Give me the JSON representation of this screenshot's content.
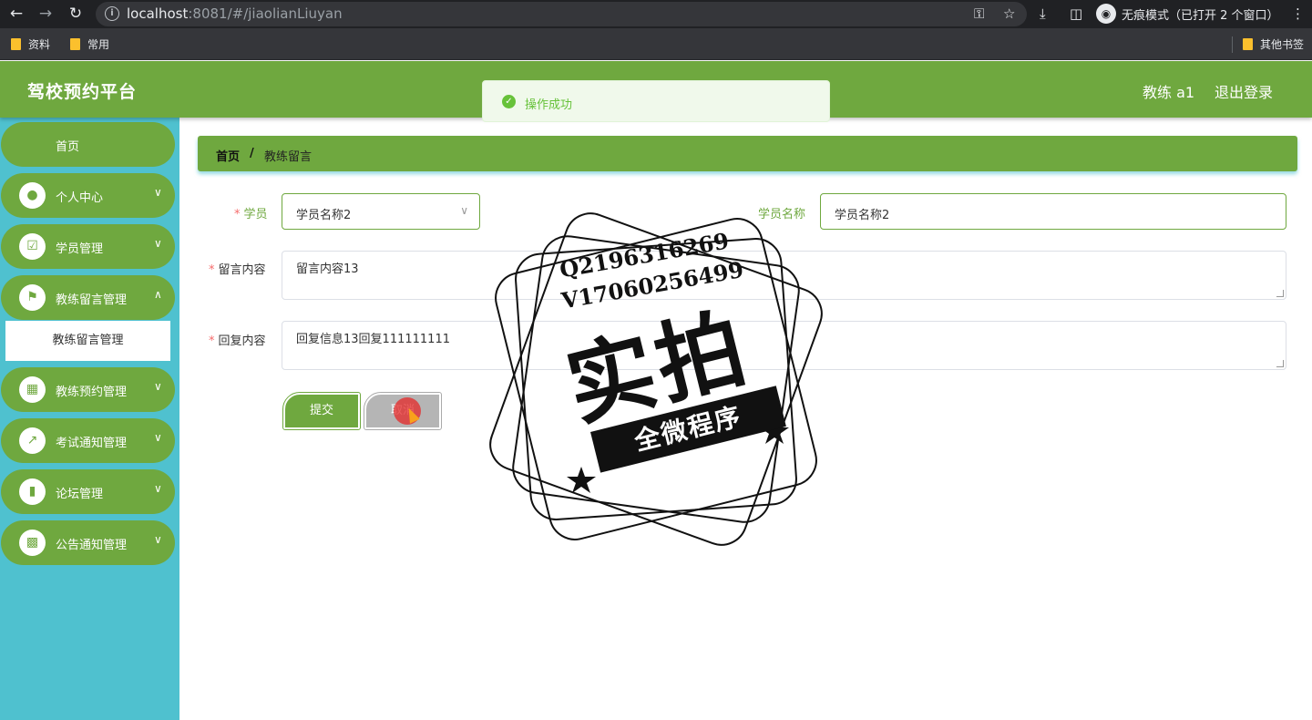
{
  "browser": {
    "url_host": "localhost",
    "url_path": ":8081/#/jiaolianLiuyan",
    "incognito_label": "无痕模式（已打开 2 个窗口）",
    "bookmarks": [
      "资料",
      "常用"
    ],
    "other_bookmarks": "其他书签",
    "icons": [
      "back-icon",
      "forward-icon",
      "reload-icon",
      "info-icon",
      "key-icon",
      "star-icon",
      "download-icon",
      "sidepanel-icon",
      "incognito-icon",
      "more-icon"
    ]
  },
  "header": {
    "title": "驾校预约平台",
    "user": "教练 a1",
    "logout": "退出登录"
  },
  "toast": {
    "message": "操作成功"
  },
  "sidebar": {
    "items": [
      {
        "label": "首页"
      },
      {
        "label": "个人中心"
      },
      {
        "label": "学员管理"
      },
      {
        "label": "教练留言管理"
      },
      {
        "label": "教练预约管理"
      },
      {
        "label": "考试通知管理"
      },
      {
        "label": "论坛管理"
      },
      {
        "label": "公告通知管理"
      }
    ],
    "sub_active": "教练留言管理"
  },
  "breadcrumb": {
    "home": "首页",
    "separator": "/",
    "current": "教练留言"
  },
  "form": {
    "student_label": "学员",
    "student_value": "学员名称2",
    "student_name_label": "学员名称",
    "student_name_value": "学员名称2",
    "message_label": "留言内容",
    "message_value": "留言内容13",
    "reply_label": "回复内容",
    "reply_value": "回复信息13回复111111111",
    "required_mark": "*",
    "submit": "提交",
    "cancel": "取消"
  },
  "watermark": {
    "line1": "Q2196316269",
    "line2": "V17060256499",
    "big": "实拍",
    "banner": "全微程序"
  },
  "colors": {
    "primary": "#6fa83f",
    "sidebar": "#4fc1cf",
    "success": "#67c23a"
  }
}
